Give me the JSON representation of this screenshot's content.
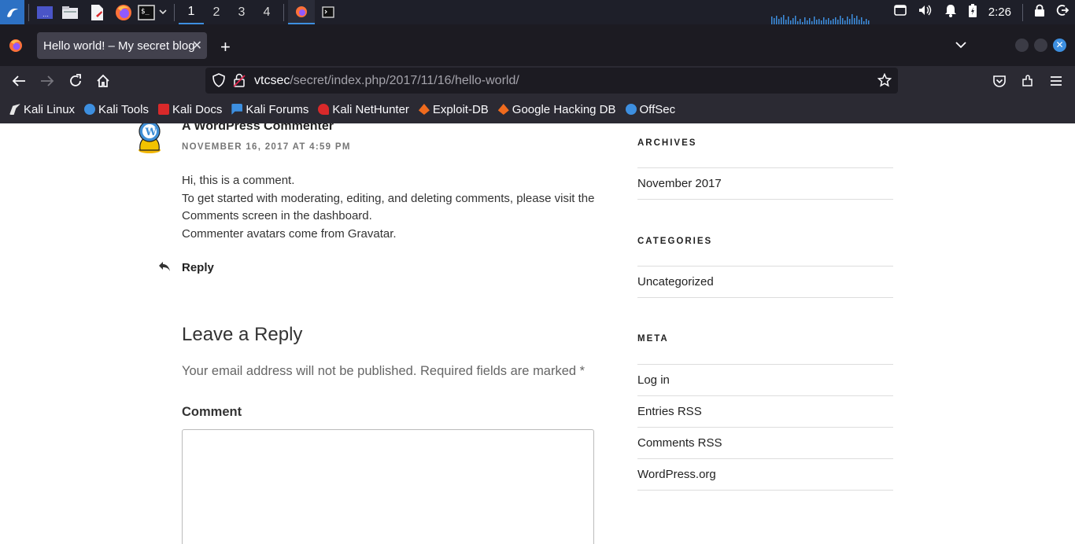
{
  "taskbar": {
    "workspaces": [
      "1",
      "2",
      "3",
      "4"
    ],
    "active_workspace": "1",
    "clock": "2:26"
  },
  "browser": {
    "tab_title": "Hello world! – My secret blog",
    "url_host": "vtcsec",
    "url_path": "/secret/index.php/2017/11/16/hello-world/",
    "bookmarks": [
      {
        "label": "Kali Linux",
        "icon": "kali-dragon-icon",
        "color": "#e6e6e6"
      },
      {
        "label": "Kali Tools",
        "icon": "kali-tools-icon",
        "color": "#3d8fe0"
      },
      {
        "label": "Kali Docs",
        "icon": "kali-docs-icon",
        "color": "#d9292a"
      },
      {
        "label": "Kali Forums",
        "icon": "kali-forums-icon",
        "color": "#3d8fe0"
      },
      {
        "label": "Kali NetHunter",
        "icon": "kali-nethunter-icon",
        "color": "#d9292a"
      },
      {
        "label": "Exploit-DB",
        "icon": "exploit-db-icon",
        "color": "#f06b1e"
      },
      {
        "label": "Google Hacking DB",
        "icon": "ghdb-icon",
        "color": "#f06b1e"
      },
      {
        "label": "OffSec",
        "icon": "offsec-icon",
        "color": "#3d8fe0"
      }
    ]
  },
  "comment": {
    "author": "A WordPress Commenter",
    "date": "NOVEMBER 16, 2017 AT 4:59 PM",
    "lines": [
      "Hi, this is a comment.",
      "To get started with moderating, editing, and deleting comments, please visit the",
      "Comments screen in the dashboard.",
      "Commenter avatars come from Gravatar."
    ],
    "reply_label": "Reply"
  },
  "reply_form": {
    "title": "Leave a Reply",
    "notes": "Your email address will not be published. Required fields are marked *",
    "comment_label": "Comment",
    "comment_value": ""
  },
  "sidebar": {
    "archives": {
      "title": "ARCHIVES",
      "items": [
        "November 2017"
      ]
    },
    "categories": {
      "title": "CATEGORIES",
      "items": [
        "Uncategorized"
      ]
    },
    "meta": {
      "title": "META",
      "items": [
        "Log in",
        "Entries RSS",
        "Comments RSS",
        "WordPress.org"
      ]
    }
  }
}
